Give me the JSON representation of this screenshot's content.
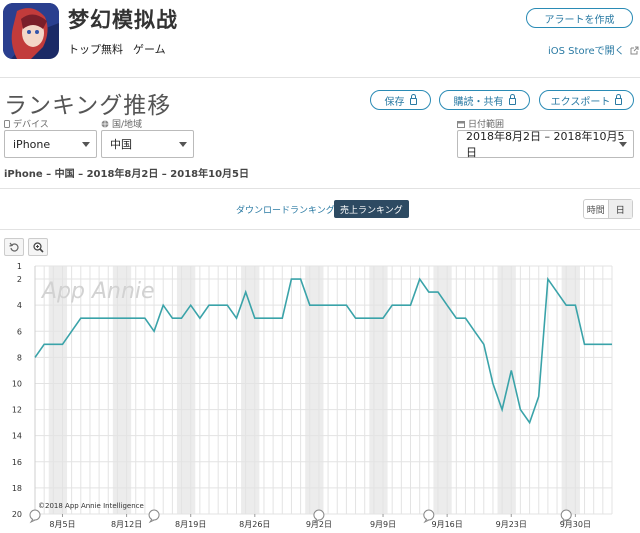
{
  "app": {
    "name": "梦幻模拟战",
    "category_rank_type": "トップ無料",
    "category": "ゲーム"
  },
  "header": {
    "alert_button": "アラートを作成",
    "store_link": "iOS Storeで開く"
  },
  "section": {
    "title": "ランキング推移"
  },
  "actions": {
    "save": "保存",
    "subscribe": "購読・共有",
    "export": "エクスポート"
  },
  "filters": {
    "device_label": "デバイス",
    "device_value": "iPhone",
    "country_label": "国/地域",
    "country_value": "中国",
    "date_label": "日付範囲",
    "date_value": "2018年8月2日 – 2018年10月5日"
  },
  "subtitle": "iPhone – 中国 – 2018年8月2日 – 2018年10月5日",
  "tabs": {
    "downloads": "ダウンロードランキング",
    "revenue": "売上ランキング"
  },
  "granularity": {
    "hourly": "時間",
    "daily": "日"
  },
  "colors": {
    "accent": "#2a8bb5",
    "line": "#3aa3a9",
    "active_tab": "#2d4a62"
  },
  "chart_data": {
    "type": "line",
    "watermark": "App Annie",
    "copyright": "©2018 App Annie Intelligence",
    "y_reversed": true,
    "ylim": [
      1,
      20
    ],
    "y_ticks": [
      1,
      2,
      4,
      6,
      8,
      10,
      12,
      14,
      16,
      18,
      20
    ],
    "x_tick_labels": [
      "8月5日",
      "8月12日",
      "8月19日",
      "8月26日",
      "9月2日",
      "9月9日",
      "9月16日",
      "9月23日",
      "9月30日"
    ],
    "x_start": "2018-08-02",
    "grid": true,
    "series": [
      {
        "values": [
          8,
          7,
          7,
          7,
          6,
          5,
          5,
          5,
          5,
          5,
          5,
          5,
          5,
          6,
          4,
          5,
          5,
          4,
          5,
          4,
          4,
          4,
          5,
          3,
          5,
          5,
          5,
          5,
          2,
          2,
          4,
          4,
          4,
          4,
          4,
          5,
          5,
          5,
          5,
          4,
          4,
          4,
          2,
          3,
          3,
          4,
          5,
          5,
          6,
          7,
          10,
          12,
          9,
          12,
          13,
          11,
          2,
          3,
          4,
          4,
          7,
          7,
          7,
          7
        ]
      }
    ]
  }
}
